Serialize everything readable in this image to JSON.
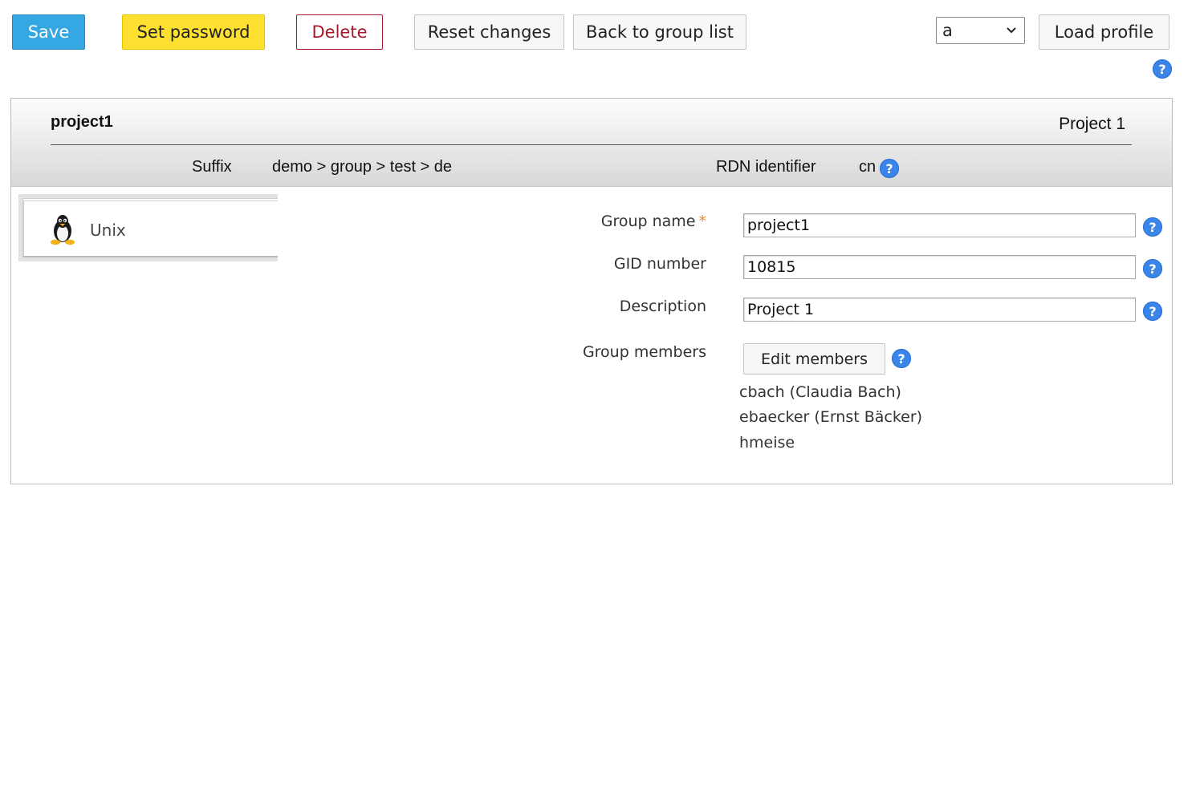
{
  "toolbar": {
    "save_label": "Save",
    "set_password_label": "Set password",
    "delete_label": "Delete",
    "reset_label": "Reset changes",
    "back_label": "Back to group list",
    "profile_value": "a",
    "load_profile_label": "Load profile",
    "help_label": "?"
  },
  "header": {
    "title": "project1",
    "description": "Project 1",
    "suffix_label": "Suffix",
    "suffix_value": "demo > group > test > de",
    "rdn_label": "RDN identifier",
    "rdn_value": "cn"
  },
  "tabs": [
    {
      "label": "Unix",
      "icon": "linux-penguin-icon"
    }
  ],
  "form": {
    "group_name_label": "Group name",
    "required_marker": "*",
    "group_name_value": "project1",
    "gid_label": "GID number",
    "gid_value": "10815",
    "description_label": "Description",
    "description_value": "Project 1",
    "members_label": "Group members",
    "edit_members_label": "Edit members",
    "members": [
      "cbach (Claudia Bach)",
      "ebaecker (Ernst Bäcker)",
      "hmeise"
    ]
  },
  "colors": {
    "save": "#35a7e2",
    "set_password": "#fde030",
    "delete": "#a6182a",
    "help": "#3a85ea",
    "required": "#e88d2a"
  }
}
